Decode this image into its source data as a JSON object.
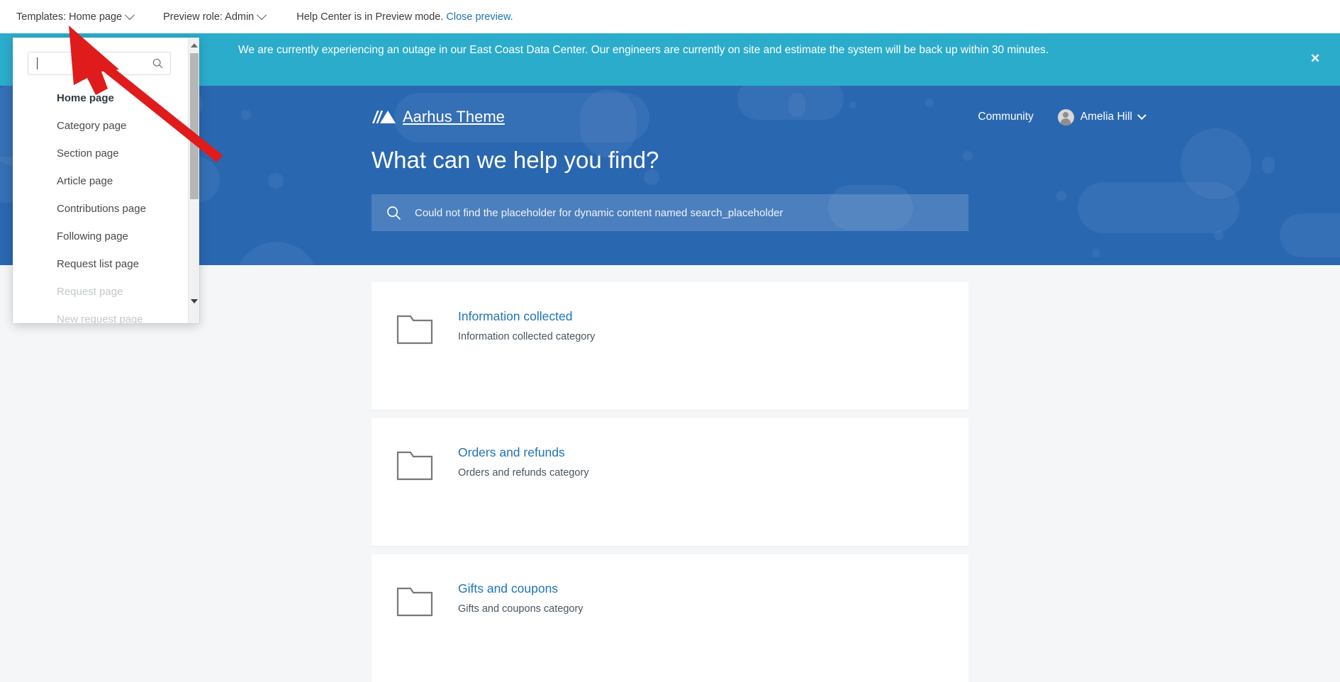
{
  "admin_bar": {
    "templates_label": "Templates: Home page",
    "preview_role_label": "Preview role: Admin",
    "preview_message": "Help Center is in Preview mode.",
    "close_preview_link": "Close preview."
  },
  "announcement": {
    "text": "We are currently experiencing an outage in our East Coast Data Center. Our engineers are currently on site and estimate the system will be back up within 30 minutes.",
    "close_icon": "close-icon",
    "background_color": "#2baccb"
  },
  "hero": {
    "brand_name": "Aarhus Theme",
    "logo_icon": "aarhus-logo-icon",
    "community_link": "Community",
    "user_name": "Amelia Hill",
    "title": "What can we help you find?",
    "search_placeholder": "Could not find the placeholder for dynamic content named search_placeholder",
    "search_icon": "search-icon",
    "background_color": "#2a67b1"
  },
  "categories": [
    {
      "title": "Information collected",
      "description": "Information collected category",
      "icon": "folder-icon"
    },
    {
      "title": "Orders and refunds",
      "description": "Orders and refunds category",
      "icon": "folder-icon"
    },
    {
      "title": "Gifts and coupons",
      "description": "Gifts and coupons category",
      "icon": "folder-icon"
    }
  ],
  "templates_dropdown": {
    "search_value": "",
    "search_icon": "search-icon",
    "items": [
      {
        "label": "Home page",
        "state": "selected"
      },
      {
        "label": "Category page",
        "state": "normal"
      },
      {
        "label": "Section page",
        "state": "normal"
      },
      {
        "label": "Article page",
        "state": "normal"
      },
      {
        "label": "Contributions page",
        "state": "normal"
      },
      {
        "label": "Following page",
        "state": "normal"
      },
      {
        "label": "Request list page",
        "state": "normal"
      },
      {
        "label": "Request page",
        "state": "disabled"
      },
      {
        "label": "New request page",
        "state": "disabled"
      }
    ]
  },
  "annotation": {
    "type": "arrow",
    "color": "#e01b1b",
    "points_to": "Templates: Home page"
  },
  "colors": {
    "page_background": "#f4f6f8",
    "link_blue": "#1f73b7",
    "card_background": "#ffffff"
  }
}
